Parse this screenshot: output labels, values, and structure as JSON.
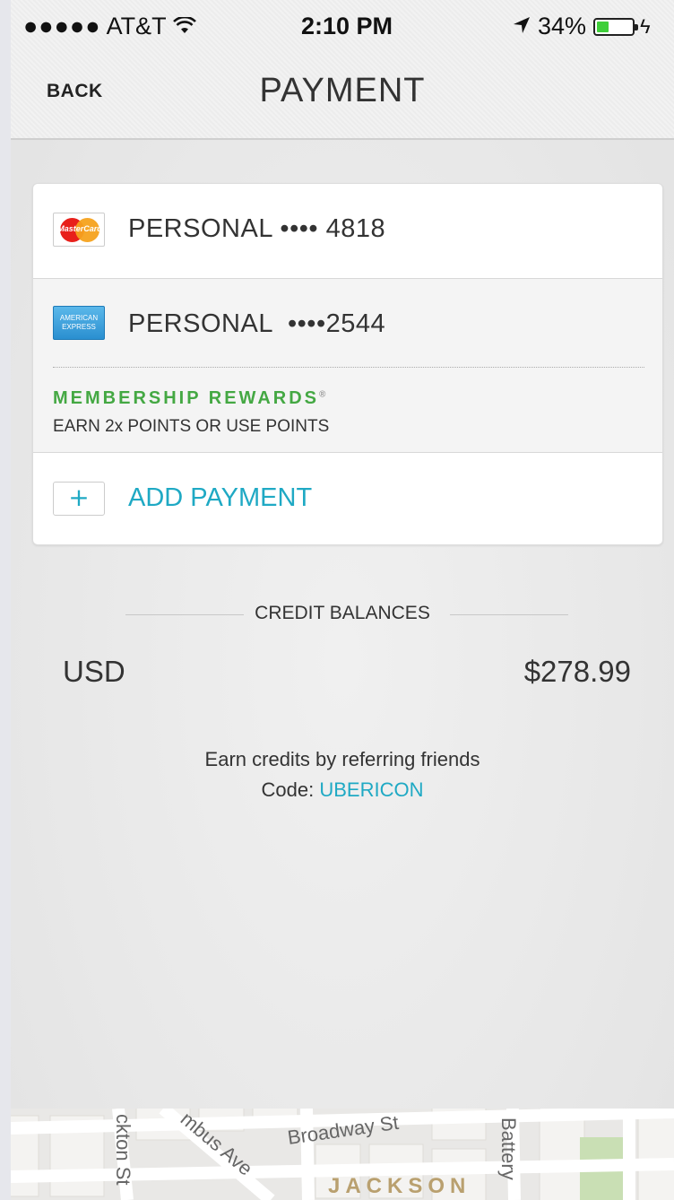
{
  "status_bar": {
    "signal": "●●●●●",
    "carrier": "AT&T",
    "time": "2:10 PM",
    "battery_percent": "34%",
    "battery_level": 0.34
  },
  "nav": {
    "back_label": "BACK",
    "title": "PAYMENT"
  },
  "payment_methods": [
    {
      "brand": "MasterCard",
      "label": "PERSONAL •••• 4818",
      "icon": "mastercard-icon"
    },
    {
      "brand": "AMERICAN EXPRESS",
      "label": "PERSONAL  ••••2544",
      "icon": "amex-icon",
      "rewards_title": "MEMBERSHIP REWARDS",
      "rewards_mark": "®",
      "rewards_subtitle": "EARN 2x POINTS OR USE POINTS"
    }
  ],
  "add_payment": {
    "label": "ADD PAYMENT",
    "icon": "plus-icon"
  },
  "credit": {
    "heading": "CREDIT BALANCES",
    "currency": "USD",
    "amount": "$278.99",
    "referral_text": "Earn credits by referring friends",
    "code_prefix": "Code:",
    "code": "UBERICON"
  },
  "map": {
    "streets": [
      "Broadway St",
      "mbus Ave",
      "ckton St",
      "Battery",
      "JACKSON"
    ]
  },
  "colors": {
    "accent": "#1fa9c4",
    "rewards_green": "#44a843",
    "battery_green": "#3fcf3a"
  }
}
